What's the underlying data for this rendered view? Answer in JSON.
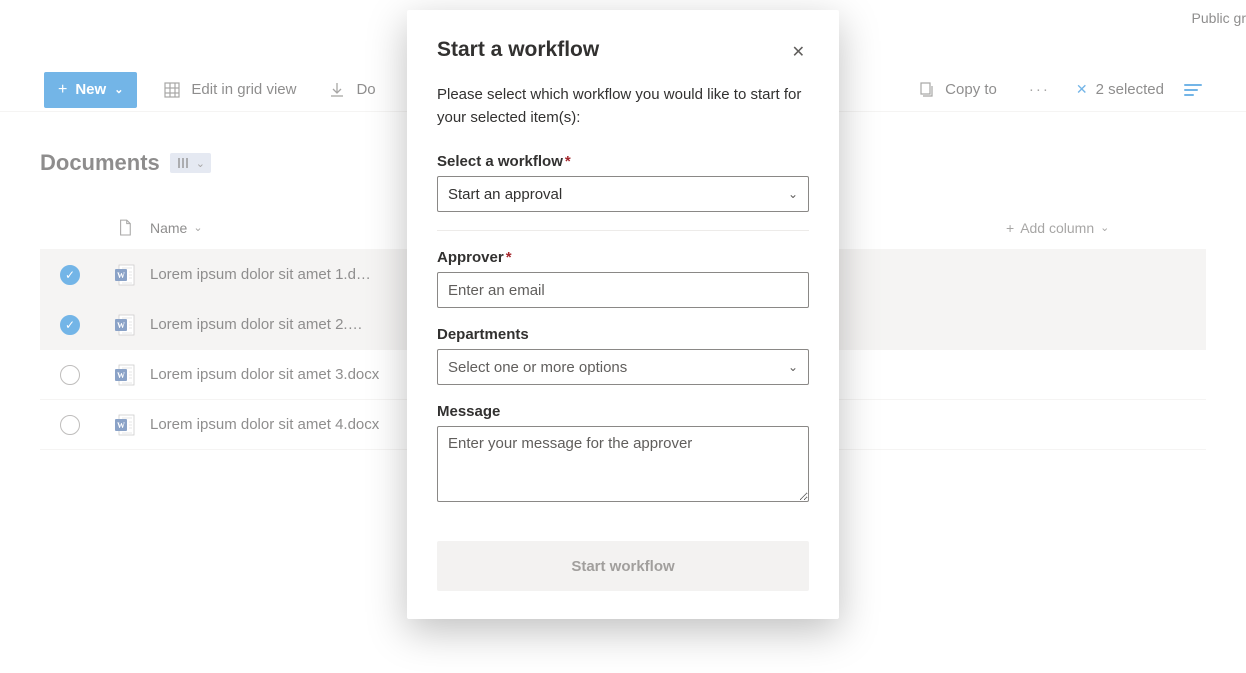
{
  "top_right": "Public gr",
  "toolbar": {
    "new_label": "New",
    "edit_grid_label": "Edit in grid view",
    "download_label": "Do",
    "copy_to_label": "Copy to",
    "selected_count": "2 selected"
  },
  "page": {
    "title": "Documents"
  },
  "columns": {
    "name": "Name",
    "add": "Add column"
  },
  "rows": [
    {
      "selected": true,
      "name": "Lorem ipsum dolor sit amet 1.d…"
    },
    {
      "selected": true,
      "name": "Lorem ipsum dolor sit amet 2.…"
    },
    {
      "selected": false,
      "name": "Lorem ipsum dolor sit amet 3.docx"
    },
    {
      "selected": false,
      "name": "Lorem ipsum dolor sit amet 4.docx"
    }
  ],
  "dialog": {
    "title": "Start a workflow",
    "description": "Please select which workflow you would like to start for your selected item(s):",
    "workflow_label": "Select a workflow",
    "workflow_value": "Start an approval",
    "approver_label": "Approver",
    "approver_placeholder": "Enter an email",
    "departments_label": "Departments",
    "departments_placeholder": "Select one or more options",
    "message_label": "Message",
    "message_placeholder": "Enter your message for the approver",
    "start_button": "Start workflow"
  }
}
